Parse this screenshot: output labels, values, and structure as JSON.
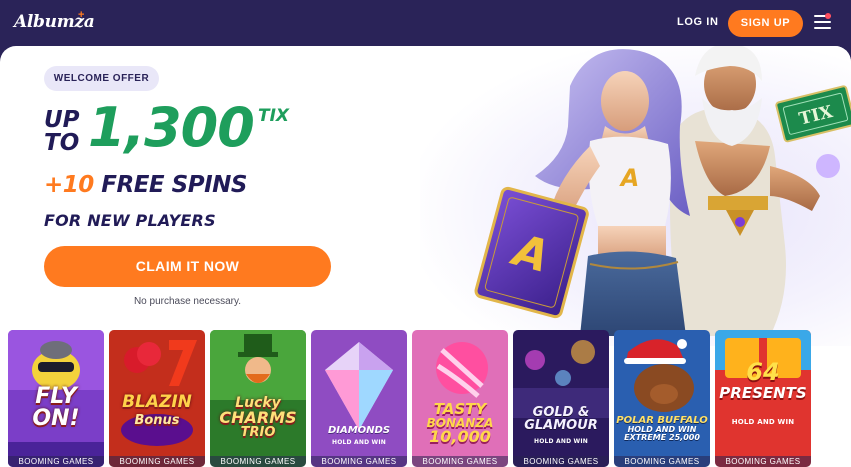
{
  "header": {
    "logo_text": "Albumza",
    "logo_mark": "+",
    "login_label": "LOG IN",
    "signup_label": "SIGN UP",
    "menu_icon": "hamburger-menu-icon",
    "notification_dot_color": "#ff4d5e"
  },
  "hero": {
    "badge": "WELCOME OFFER",
    "headline_up": "UP",
    "headline_to": "TO",
    "headline_amount": "1,300",
    "headline_currency": "TIX",
    "spins_count": "+10",
    "spins_label": "FREE SPINS",
    "subline": "FOR NEW PLAYERS",
    "cta_label": "CLAIM IT NOW",
    "disclaimer": "No purchase necessary.",
    "art_card_letter": "A",
    "art_tix_text": "TIX"
  },
  "games": [
    {
      "title": "FLY ON!",
      "title_lines": [
        "FLY",
        "ON!"
      ],
      "subtitle": "",
      "provider": "BOOMING GAMES"
    },
    {
      "title": "BLAZIN Bonus",
      "title_lines": [
        "BLAZIN",
        "Bonus"
      ],
      "subtitle": "",
      "provider": "BOOMING GAMES"
    },
    {
      "title": "Lucky CHARMS TRIO",
      "title_lines": [
        "Lucky",
        "CHARMS",
        "TRIO"
      ],
      "subtitle": "",
      "provider": "BOOMING GAMES"
    },
    {
      "title": "DIAMONDS DIAMONDS",
      "title_lines": [
        "DIAMONDS"
      ],
      "subtitle": "HOLD AND WIN",
      "provider": "BOOMING GAMES"
    },
    {
      "title": "TASTY BONANZA 10,000",
      "title_lines": [
        "TASTY",
        "BONANZA",
        "10,000"
      ],
      "subtitle": "",
      "provider": "BOOMING GAMES"
    },
    {
      "title": "GOLD & GLAMOUR",
      "title_lines": [
        "GOLD &",
        "GLAMOUR"
      ],
      "subtitle": "HOLD AND WIN",
      "provider": "BOOMING GAMES"
    },
    {
      "title": "POLAR BUFFALO HOLD AND WIN EXTREME 25,000",
      "title_lines": [
        "POLAR BUFFALO",
        "HOLD AND WIN",
        "EXTREME 25,000"
      ],
      "subtitle": "",
      "provider": "BOOMING GAMES"
    },
    {
      "title": "64 PRESENTS HOLD AND WIN",
      "title_lines": [
        "64",
        "PRESENTS"
      ],
      "subtitle": "HOLD AND WIN",
      "provider": "BOOMING GAMES"
    }
  ],
  "colors": {
    "brand_navy": "#2a2358",
    "accent_orange": "#ff7a1f",
    "accent_green": "#1e9e5c",
    "text_navy": "#211b57",
    "badge_bg": "#e9e7f8"
  }
}
